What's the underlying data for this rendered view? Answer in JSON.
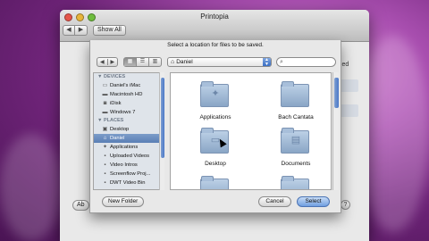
{
  "window": {
    "title": "Printopia",
    "nav_back": "◀",
    "nav_forward": "▶",
    "show_all": "Show All",
    "behind_text": "bled",
    "behind_button": "Ab",
    "help": "?"
  },
  "sheet": {
    "message": "Select a location for files to be saved.",
    "back": "◀",
    "forward": "▶",
    "views": [
      "▦",
      "☰",
      "▥"
    ],
    "path": "Daniel",
    "search_placeholder": "",
    "new_folder": "New Folder",
    "cancel": "Cancel",
    "select": "Select"
  },
  "sidebar": {
    "devices_header": "▼ DEVICES",
    "devices": [
      {
        "label": "Daniel's iMac",
        "icon": "imac-icon",
        "glyph": "▭"
      },
      {
        "label": "Macintosh HD",
        "icon": "hard-drive-icon",
        "glyph": "▬"
      },
      {
        "label": "iDisk",
        "icon": "idisk-icon",
        "glyph": "◙"
      },
      {
        "label": "Windows 7",
        "icon": "drive-icon",
        "glyph": "▬"
      }
    ],
    "places_header": "▼ PLACES",
    "places": [
      {
        "label": "Desktop",
        "icon": "desktop-icon",
        "glyph": "▣"
      },
      {
        "label": "Daniel",
        "icon": "home-icon",
        "glyph": "⌂",
        "selected": true
      },
      {
        "label": "Applications",
        "icon": "applications-icon",
        "glyph": "✦"
      },
      {
        "label": "Uploaded Videos",
        "icon": "folder-icon",
        "glyph": "▪"
      },
      {
        "label": "Video Intros",
        "icon": "folder-icon",
        "glyph": "▪"
      },
      {
        "label": "Screenflow Proj...",
        "icon": "folder-icon",
        "glyph": "▪"
      },
      {
        "label": "DWT Video Bin",
        "icon": "folder-icon",
        "glyph": "▪"
      }
    ]
  },
  "folders": [
    {
      "label": "Applications",
      "icon": "applications-folder-icon",
      "glyph": "✦"
    },
    {
      "label": "Bach Cantata",
      "icon": "folder-icon",
      "glyph": ""
    },
    {
      "label": "Desktop",
      "icon": "desktop-folder-icon",
      "glyph": "▭"
    },
    {
      "label": "Documents",
      "icon": "documents-folder-icon",
      "glyph": "▤"
    },
    {
      "label": "",
      "icon": "folder-icon",
      "glyph": ""
    },
    {
      "label": "",
      "icon": "folder-icon",
      "glyph": ""
    }
  ]
}
